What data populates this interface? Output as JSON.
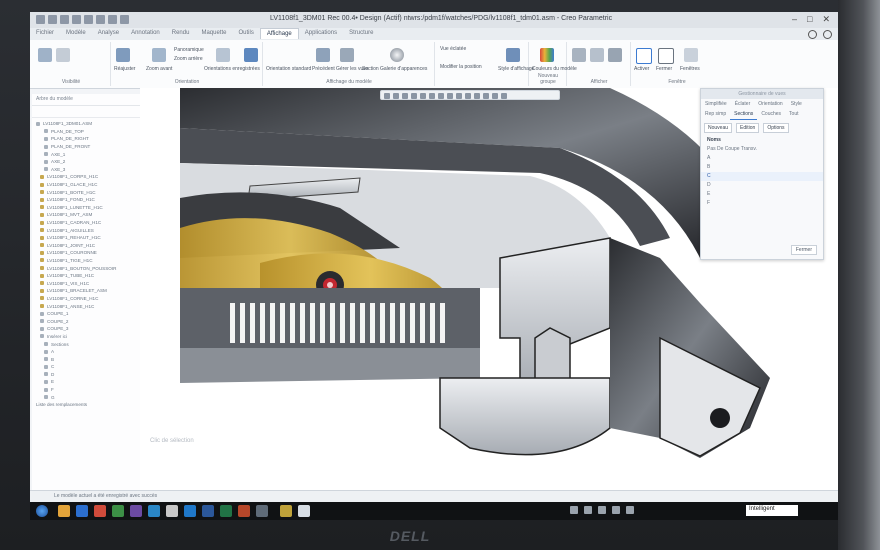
{
  "window": {
    "title": "LV1108f1_3DM01 Rec 00.4• Design (Actif) ntwrs:/pdm1f/watches/PDG/lv1108f1_tdm01.asm - Creo Parametric"
  },
  "ribbon_tabs": [
    "Fichier",
    "Modèle",
    "Analyse",
    "Annotation",
    "Rendu",
    "Maquette",
    "Outils",
    "Affichage",
    "Applications",
    "Structure"
  ],
  "active_tab": "Affichage",
  "ribbon": {
    "groups": [
      {
        "label": "Visibilité"
      },
      {
        "label": "Orientation"
      },
      {
        "label": "Affichage du modèle"
      },
      {
        "label": "Nouveau groupe"
      },
      {
        "label": "Afficher"
      },
      {
        "label": "Fenêtre"
      }
    ],
    "items": {
      "zoom_avant": "Zoom avant",
      "zoom_arriere": "Zoom arrière",
      "reajuster": "Réajuster",
      "panoramique": "Panoramique",
      "orientations_enregistrees": "Orientations enregistrées",
      "orientation_standard": "Orientation standard",
      "precedent": "Précédent",
      "gerer_vues": "Gérer les vues",
      "section": "Section",
      "galerie_apparences": "Galerie d'apparences",
      "vue_eclatee": "Vue éclatée",
      "modifier_position": "Modifier la position",
      "style_affichage": "Style d'affichage",
      "couleurs_modele": "Couleurs du modèle",
      "activer": "Activer",
      "fermer": "Fermer",
      "fenetres": "Fenêtres"
    }
  },
  "tree": {
    "header": "Arbre du modèle",
    "items": [
      "LV1108F1_3DM01.ASM",
      "PLAN_DE_TOP",
      "PLAN_DE_RIGHT",
      "PLAN_DE_FRONT",
      "AXE_1",
      "AXE_2",
      "AXE_3",
      "LV1108F1_CORPS_H1C",
      "LV1108F1_GLACE_H1C",
      "LV1108F1_BOITE_H1C",
      "LV1108F1_FOND_H1C",
      "LV1108F1_LUNETTE_H1C",
      "LV1108F1_MVT_ASM",
      "LV1108F1_CADRAN_H1C",
      "LV1108F1_AIGUILLES",
      "LV1108F1_REHAUT_H1C",
      "LV1108F1_JOINT_H1C",
      "LV1108F1_COURONNE",
      "LV1108F1_TIGE_H1C",
      "LV1108F1_BOUTON_POUSSOIR",
      "LV1108F1_TUBE_H1C",
      "LV1108F1_VIS_H1C",
      "LV1108F1_BRACELET_ASM",
      "LV1108F1_CORNE_H1C",
      "LV1108F1_ANSE_H1C",
      "COUPE_1",
      "COUPE_2",
      "COUPE_3",
      "Insérer ici",
      "Sections",
      "A",
      "B",
      "C",
      "D",
      "E",
      "F",
      "G"
    ],
    "footer": "Liste des remplacements"
  },
  "panel": {
    "title": "Gestionnaire de vues",
    "tabs": [
      "Simplifiée",
      "Éclater",
      "Orientation",
      "Style",
      "Rep simp",
      "Sections",
      "Couches",
      "Tout"
    ],
    "active_tab": "Sections",
    "toolbar": {
      "nouveau": "Nouveau",
      "edition": "Edition",
      "options": "Options"
    },
    "list_header": "Noms",
    "list": [
      "Pas De Coupe Transv.",
      "A",
      "B",
      "C",
      "D",
      "E",
      "F"
    ],
    "selected": "C",
    "close": "Fermer"
  },
  "viewport": {
    "note": "Clic de sélection"
  },
  "status": {
    "message": "Le modèle actuel a été enregistré avec succès"
  },
  "taskbar": {
    "smart_select": "Intelligent"
  },
  "monitor_brand": "DELL",
  "colors": {
    "gold": "#c9a640",
    "steel": "#5b5f66",
    "dark": "#1d1e22",
    "accent": "#3d7bd1"
  }
}
